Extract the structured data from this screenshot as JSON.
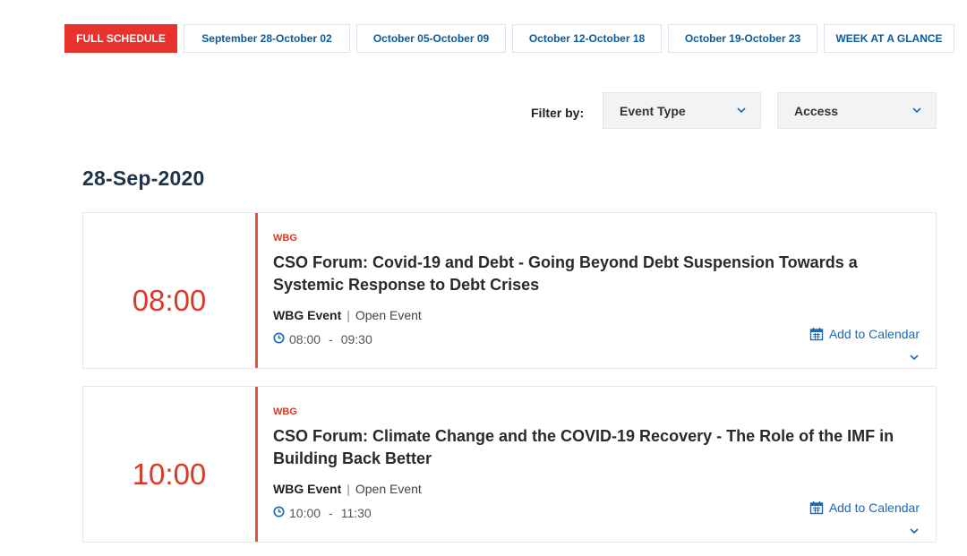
{
  "tabs": [
    {
      "label": "FULL SCHEDULE",
      "active": true
    },
    {
      "label": "September 28-October 02",
      "active": false
    },
    {
      "label": "October 05-October 09",
      "active": false
    },
    {
      "label": "October 12-October 18",
      "active": false
    },
    {
      "label": "October 19-October 23",
      "active": false
    },
    {
      "label": "WEEK AT A GLANCE",
      "active": false
    }
  ],
  "filter": {
    "label": "Filter by:",
    "event_type": "Event Type",
    "access": "Access"
  },
  "date_heading": "28-Sep-2020",
  "events": [
    {
      "time": "08:00",
      "org": "WBG",
      "title": "CSO Forum: Covid-19 and Debt - Going Beyond Debt Suspension Towards a Systemic Response to Debt Crises",
      "type": "WBG Event",
      "separator": "|",
      "access": "Open Event",
      "start": "08:00",
      "dash": "-",
      "end": "09:30",
      "add_calendar": "Add to Calendar"
    },
    {
      "time": "10:00",
      "org": "WBG",
      "title": "CSO Forum: Climate Change and the COVID-19 Recovery - The Role of the IMF in Building Back Better",
      "type": "WBG Event",
      "separator": "|",
      "access": "Open Event",
      "start": "10:00",
      "dash": "-",
      "end": "11:30",
      "add_calendar": "Add to Calendar"
    }
  ],
  "colors": {
    "accent_red": "#e8322e",
    "link_blue": "#1a69b8",
    "tab_blue": "#0a5a9c",
    "heading_navy": "#1f3347"
  },
  "icons": {
    "clock": "clock-icon",
    "calendar": "calendar-icon",
    "chevron": "chevron-down-icon"
  }
}
